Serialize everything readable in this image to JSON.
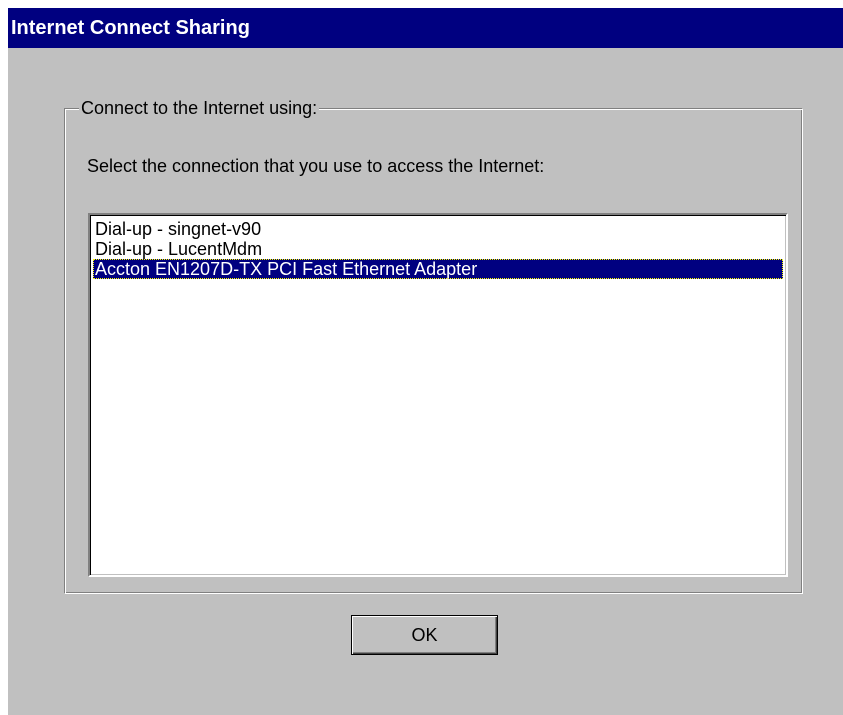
{
  "window": {
    "title": "Internet Connect Sharing"
  },
  "group": {
    "label": "Connect to the Internet using:",
    "instruction": "Select the connection that you use to access the Internet:"
  },
  "connections": {
    "items": [
      {
        "label": "Dial-up - singnet-v90",
        "selected": false
      },
      {
        "label": "Dial-up - LucentMdm",
        "selected": false
      },
      {
        "label": "Accton EN1207D-TX PCI Fast Ethernet Adapter",
        "selected": true
      }
    ]
  },
  "buttons": {
    "ok_label": "OK"
  },
  "colors": {
    "titlebar": "#000080",
    "dialog_face": "#c0c0c0",
    "selection": "#000080"
  }
}
